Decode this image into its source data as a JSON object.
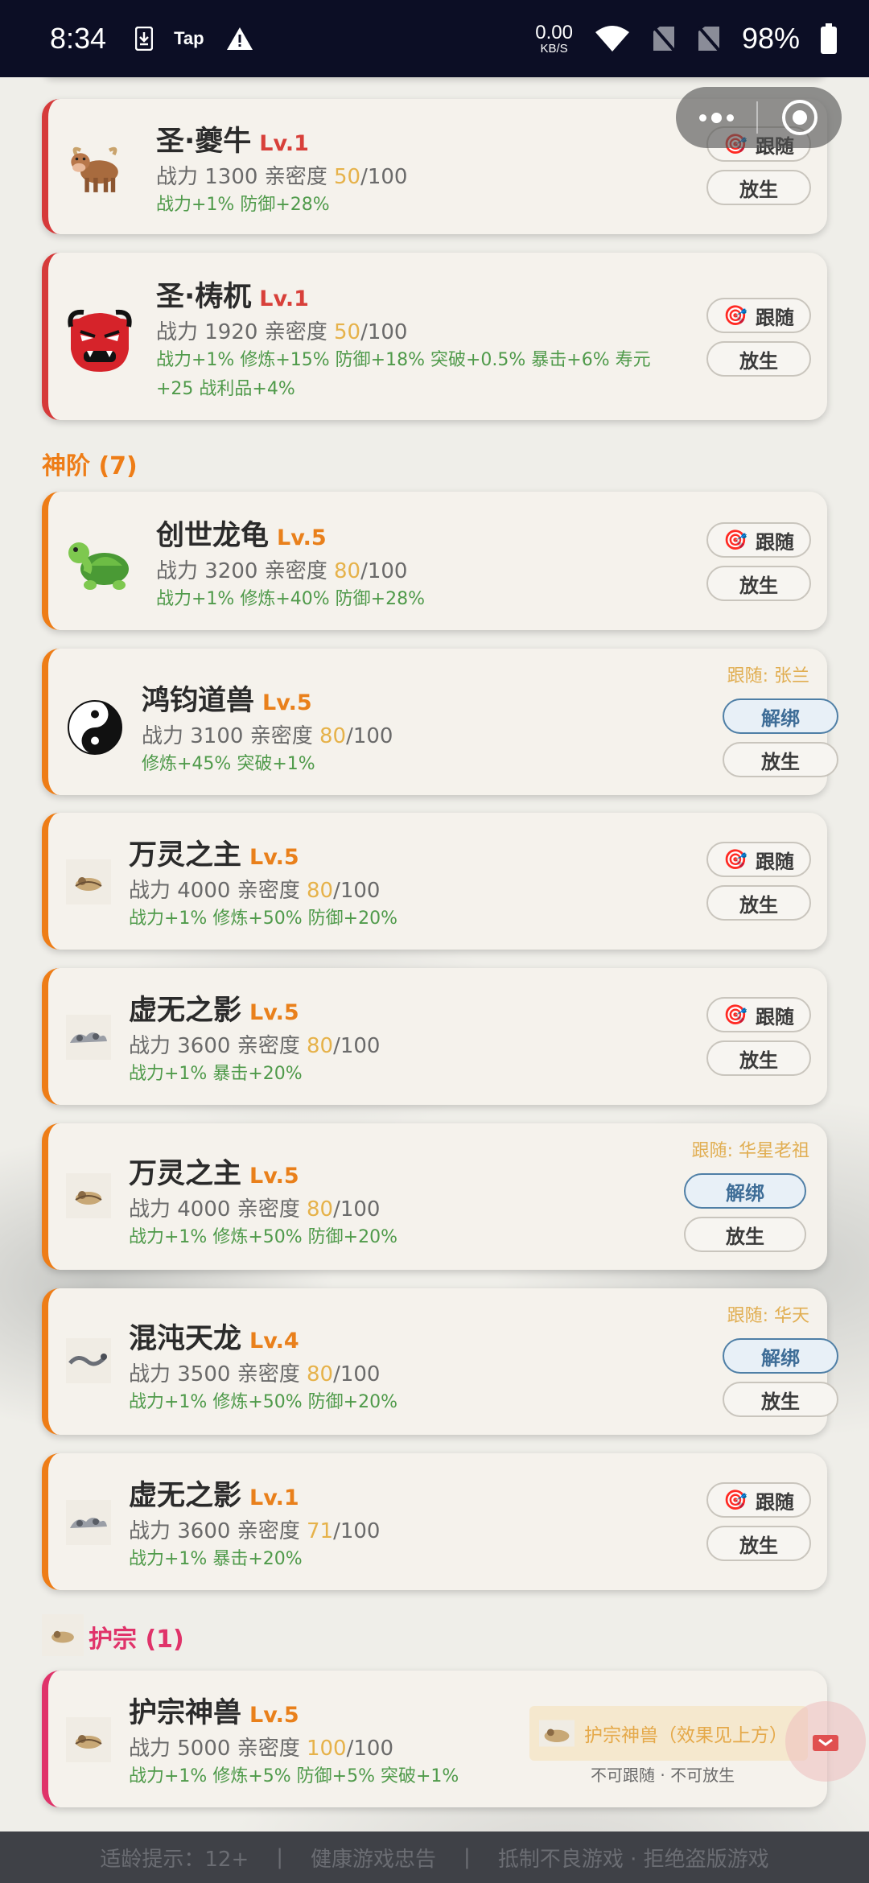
{
  "status_bar": {
    "time": "8:34",
    "tap_label": "Tap",
    "speed_value": "0.00",
    "speed_unit": "KB/S",
    "battery": "98%"
  },
  "cards": [
    {
      "name": "圣·夔牛",
      "level": "Lv.1",
      "power_label": "战力 1300 亲密度 ",
      "affinity": "50",
      "affinity_max": "/100",
      "bonus": "战力+1% 防御+28%",
      "icon": "ox-icon",
      "follow_label": "跟随",
      "release_label": "放生"
    },
    {
      "name": "圣·梼杌",
      "level": "Lv.1",
      "power_label": "战力 1920 亲密度 ",
      "affinity": "50",
      "affinity_max": "/100",
      "bonus": "战力+1% 修炼+15% 防御+18% 突破+0.5% 暴击+6% 寿元+25 战利品+4%",
      "icon": "ogre-icon",
      "follow_label": "跟随",
      "release_label": "放生"
    },
    {
      "name": "创世龙龟",
      "level": "Lv.5",
      "power_label": "战力 3200 亲密度 ",
      "affinity": "80",
      "affinity_max": "/100",
      "bonus": "战力+1% 修炼+40% 防御+28%",
      "icon": "turtle-icon",
      "follow_label": "跟随",
      "release_label": "放生"
    },
    {
      "name": "鸿钧道兽",
      "level": "Lv.5",
      "power_label": "战力 3100 亲密度 ",
      "affinity": "80",
      "affinity_max": "/100",
      "bonus": "修炼+45% 突破+1%",
      "icon": "yin-yang-icon",
      "followed_by": "跟随: 张兰",
      "unbind_label": "解绑",
      "release_label": "放生"
    },
    {
      "name": "万灵之主",
      "level": "Lv.5",
      "power_label": "战力 4000 亲密度 ",
      "affinity": "80",
      "affinity_max": "/100",
      "bonus": "战力+1% 修炼+50% 防御+20%",
      "icon": "beast-thumbnail",
      "follow_label": "跟随",
      "release_label": "放生"
    },
    {
      "name": "虚无之影",
      "level": "Lv.5",
      "power_label": "战力 3600 亲密度 ",
      "affinity": "80",
      "affinity_max": "/100",
      "bonus": "战力+1% 暴击+20%",
      "icon": "shadow-thumbnail",
      "follow_label": "跟随",
      "release_label": "放生"
    },
    {
      "name": "万灵之主",
      "level": "Lv.5",
      "power_label": "战力 4000 亲密度 ",
      "affinity": "80",
      "affinity_max": "/100",
      "bonus": "战力+1% 修炼+50% 防御+20%",
      "icon": "beast-thumbnail",
      "followed_by": "跟随: 华星老祖",
      "unbind_label": "解绑",
      "release_label": "放生"
    },
    {
      "name": "混沌天龙",
      "level": "Lv.4",
      "power_label": "战力 3500 亲密度 ",
      "affinity": "80",
      "affinity_max": "/100",
      "bonus": "战力+1% 修炼+50% 防御+20%",
      "icon": "dragon-thumbnail",
      "followed_by": "跟随: 华天",
      "unbind_label": "解绑",
      "release_label": "放生"
    },
    {
      "name": "虚无之影",
      "level": "Lv.1",
      "power_label": "战力 3600 亲密度 ",
      "affinity": "71",
      "affinity_max": "/100",
      "bonus": "战力+1% 暴击+20%",
      "icon": "shadow-thumbnail",
      "follow_label": "跟随",
      "release_label": "放生"
    },
    {
      "name": "护宗神兽",
      "level": "Lv.5",
      "power_label": "战力 5000 亲密度 ",
      "affinity": "100",
      "affinity_max": "/100",
      "bonus": "战力+1% 修炼+5% 防御+5% 突破+1%",
      "icon": "beast-thumbnail",
      "guard_note": "护宗神兽（效果见上方）",
      "guard_sub": "不可跟随 · 不可放生"
    }
  ],
  "sections": {
    "divine": "神阶 (7)",
    "guardian": "护宗 (1)"
  },
  "footer": {
    "age": "适龄提示：12+",
    "advice": "健康游戏忠告",
    "slogan": "抵制不良游戏 · 拒绝盗版游戏"
  },
  "colors": {
    "status_bar_bg": "#0c0e25",
    "red_rank": "#d63a3a",
    "orange_rank": "#ee7d17",
    "guardian_rank": "#e0336a",
    "bonus_green": "#4f9a4a",
    "affinity_gold": "#e6b24a"
  }
}
